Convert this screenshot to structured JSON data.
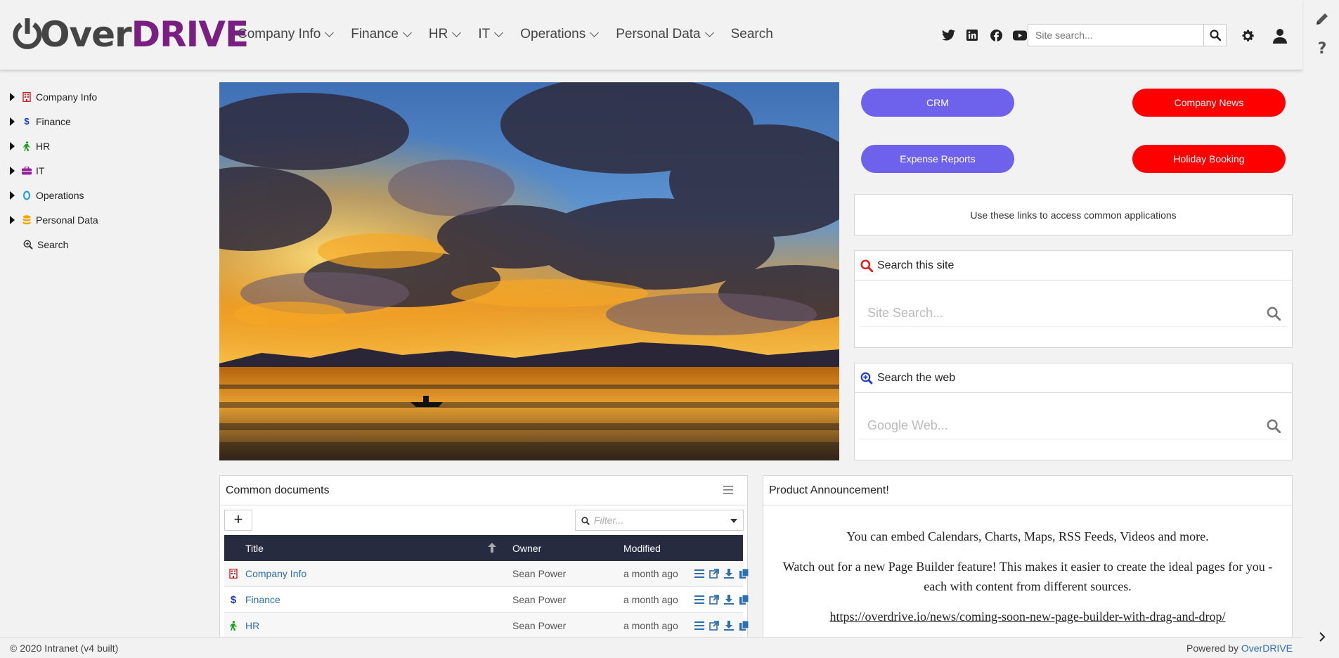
{
  "header": {
    "logo_text_1": "Over",
    "logo_text_2": "DRIVE",
    "nav": [
      {
        "label": "Company Info",
        "has_menu": true
      },
      {
        "label": "Finance",
        "has_menu": true
      },
      {
        "label": "HR",
        "has_menu": true
      },
      {
        "label": "IT",
        "has_menu": true
      },
      {
        "label": "Operations",
        "has_menu": true
      },
      {
        "label": "Personal Data",
        "has_menu": true
      },
      {
        "label": "Search",
        "has_menu": false
      }
    ],
    "social": [
      "twitter-icon",
      "linkedin-icon",
      "facebook-icon",
      "youtube-icon"
    ],
    "search_placeholder": "Site search..."
  },
  "sidebar": {
    "items": [
      {
        "label": "Company Info",
        "icon": "building-icon",
        "color": "#d21b1b",
        "expandable": true
      },
      {
        "label": "Finance",
        "icon": "dollar-icon",
        "color": "#1a37c9",
        "expandable": true
      },
      {
        "label": "HR",
        "icon": "person-walking-icon",
        "color": "#1e9e1e",
        "expandable": true
      },
      {
        "label": "IT",
        "icon": "briefcase-icon",
        "color": "#9b1fa1",
        "expandable": true
      },
      {
        "label": "Operations",
        "icon": "circle-o-icon",
        "color": "#23a3d6",
        "expandable": true
      },
      {
        "label": "Personal Data",
        "icon": "database-icon",
        "color": "#f0a500",
        "expandable": true
      },
      {
        "label": "Search",
        "icon": "search-plus-icon",
        "color": "#333333",
        "expandable": false
      }
    ]
  },
  "apps": {
    "crm": "CRM",
    "company_news": "Company News",
    "expense_reports": "Expense Reports",
    "holiday_booking": "Holiday Booking",
    "note": "Use these links to access common applications"
  },
  "search_site": {
    "title": "Search this site",
    "placeholder": "Site Search..."
  },
  "search_web": {
    "title": "Search the web",
    "placeholder": "Google Web..."
  },
  "documents": {
    "title": "Common documents",
    "add_label": "+",
    "filter_placeholder": "Filter...",
    "columns": {
      "title": "Title",
      "owner": "Owner",
      "modified": "Modified"
    },
    "rows": [
      {
        "title": "Company Info",
        "owner": "Sean Power",
        "modified": "a month ago",
        "icon": "building-icon",
        "color": "#d21b1b"
      },
      {
        "title": "Finance",
        "owner": "Sean Power",
        "modified": "a month ago",
        "icon": "dollar-icon",
        "color": "#1a37c9"
      },
      {
        "title": "HR",
        "owner": "Sean Power",
        "modified": "a month ago",
        "icon": "person-walking-icon",
        "color": "#1e9e1e"
      }
    ]
  },
  "announcement": {
    "title": "Product Announcement!",
    "line1": "You can embed Calendars, Charts, Maps, RSS Feeds, Videos and more.",
    "line2": "Watch out for a new Page Builder feature! This makes it easier to create the ideal pages for you - each with content from different sources.",
    "link": "https://overdrive.io/news/coming-soon-new-page-builder-with-drag-and-drop/"
  },
  "footer": {
    "left": "© 2020 Intranet (v4 built)",
    "right_prefix": "Powered by ",
    "right_brand": "OverDRIVE"
  }
}
